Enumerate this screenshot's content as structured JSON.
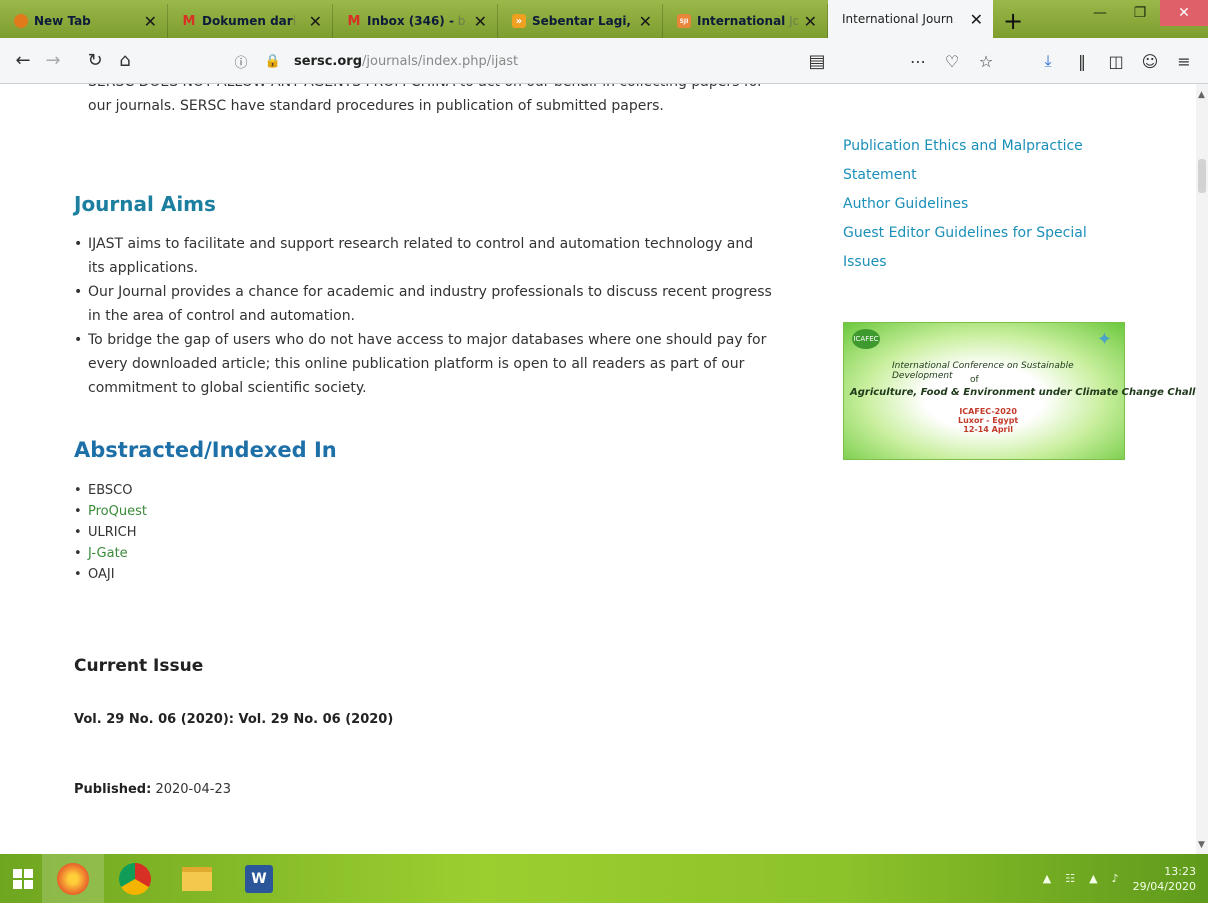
{
  "browser": {
    "tabs": [
      {
        "title": "New Tab",
        "faded": "",
        "icon_color": "#e07a1a"
      },
      {
        "title": "Dokumen dar",
        "faded": "i",
        "icon_color": "#d93025",
        "icon": "M"
      },
      {
        "title": "Inbox (346) -",
        "faded": " b",
        "icon_color": "#d93025",
        "icon": "M"
      },
      {
        "title": "Sebentar Lagi,",
        "faded": " I",
        "icon_color": "#f0a020",
        "icon": "»"
      },
      {
        "title": "International",
        "faded": " Jo",
        "icon_color": "#e8873a",
        "icon": "SJI"
      },
      {
        "title": "International Journ",
        "faded": "",
        "icon_color": "",
        "icon": ""
      }
    ],
    "new_tab_symbol": "+",
    "close_symbol": "✕",
    "url_host": "sersc.org",
    "url_path": "/journals/index.php/ijast"
  },
  "main": {
    "cutoff_line": "SERSC DOES NOT ALLOW ANY AGENTS FROM CHINA to act on our behalf in collecting papers for our journals. SERSC have standard procedures in publication of submitted papers.",
    "aims_heading": "Journal Aims",
    "aims": [
      "IJAST aims to facilitate and support research related to control and automation technology and its applications.",
      "Our Journal provides a chance for academic and industry professionals to discuss recent progress in the area of control and automation.",
      "To bridge the gap of users who do not have access to major databases where one should pay for every downloaded article; this online publication platform is open to all readers as part of our commitment to global scientific society."
    ],
    "indexed_heading": "Abstracted/Indexed In",
    "indexed": [
      "EBSCO",
      "ProQuest",
      "ULRICH",
      "J-Gate",
      "OAJI"
    ],
    "current_issue_heading": "Current Issue",
    "issue_title": "Vol. 29 No. 06 (2020): Vol. 29 No. 06 (2020)",
    "published_label": "Published:",
    "published_date": "2020-04-23"
  },
  "sidebar": {
    "links": [
      "Publication Ethics and Malpractice Statement",
      "Author Guidelines",
      "Guest Editor Guidelines for Special Issues"
    ],
    "banner": {
      "line1": "International Conference on Sustainable Development",
      "line2": "of",
      "line3": "Agriculture, Food & Environment under Climate Change Challenge",
      "line4": "ICAFEC-2020\nLuxor - Egypt\n12-14 April"
    }
  },
  "taskbar": {
    "time": "13:23",
    "date": "29/04/2020"
  }
}
